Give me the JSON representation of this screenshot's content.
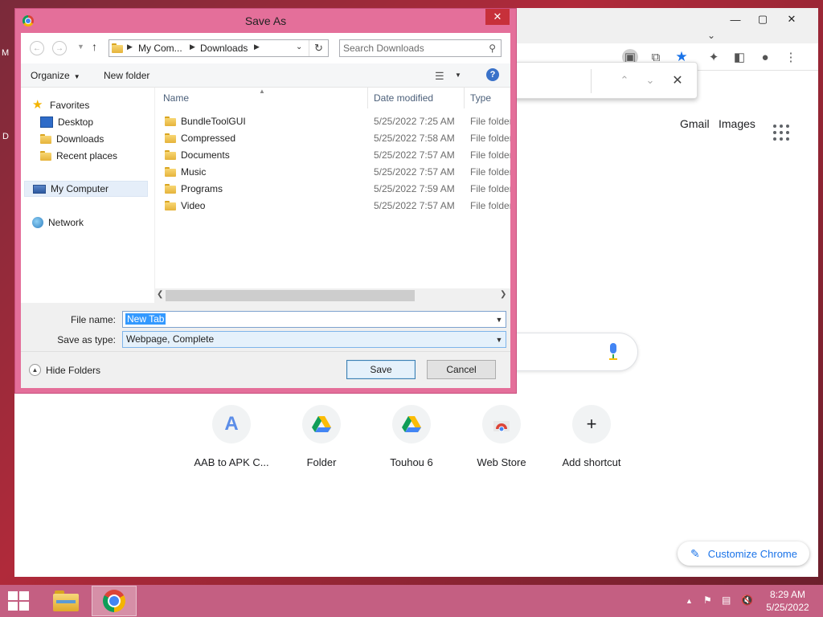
{
  "desktop": {
    "edge_letters": [
      "M",
      "D"
    ]
  },
  "chrome": {
    "top_links": {
      "gmail": "Gmail",
      "images": "Images"
    },
    "shortcuts": [
      {
        "label": "AAB to APK C...",
        "icon": "letter-a-icon",
        "glyph": "A"
      },
      {
        "label": "Folder",
        "icon": "google-drive-icon"
      },
      {
        "label": "Touhou 6",
        "icon": "google-drive-icon"
      },
      {
        "label": "Web Store",
        "icon": "web-store-icon"
      },
      {
        "label": "Add shortcut",
        "icon": "plus-icon",
        "glyph": "+"
      }
    ],
    "customize_label": "Customize Chrome",
    "accent": "#1a73e8"
  },
  "dialog": {
    "title": "Save As",
    "breadcrumb": [
      "My Com...",
      "Downloads"
    ],
    "search_placeholder": "Search Downloads",
    "organize_label": "Organize",
    "new_folder_label": "New folder",
    "nav": {
      "favorites": "Favorites",
      "desktop": "Desktop",
      "downloads": "Downloads",
      "recent": "Recent places",
      "computer": "My Computer",
      "network": "Network"
    },
    "columns": {
      "name": "Name",
      "date": "Date modified",
      "type": "Type"
    },
    "files": [
      {
        "name": "BundleToolGUI",
        "date": "5/25/2022 7:25 AM",
        "type": "File folder"
      },
      {
        "name": "Compressed",
        "date": "5/25/2022 7:58 AM",
        "type": "File folder"
      },
      {
        "name": "Documents",
        "date": "5/25/2022 7:57 AM",
        "type": "File folder"
      },
      {
        "name": "Music",
        "date": "5/25/2022 7:57 AM",
        "type": "File folder"
      },
      {
        "name": "Programs",
        "date": "5/25/2022 7:59 AM",
        "type": "File folder"
      },
      {
        "name": "Video",
        "date": "5/25/2022 7:57 AM",
        "type": "File folder"
      }
    ],
    "file_name_label": "File name:",
    "file_name_value": "New Tab",
    "save_type_label": "Save as type:",
    "save_type_value": "Webpage, Complete",
    "hide_folders_label": "Hide Folders",
    "save_label": "Save",
    "cancel_label": "Cancel",
    "frame_color": "#e46f9a"
  },
  "taskbar": {
    "time": "8:29 AM",
    "date": "5/25/2022",
    "color": "#c45f82"
  }
}
